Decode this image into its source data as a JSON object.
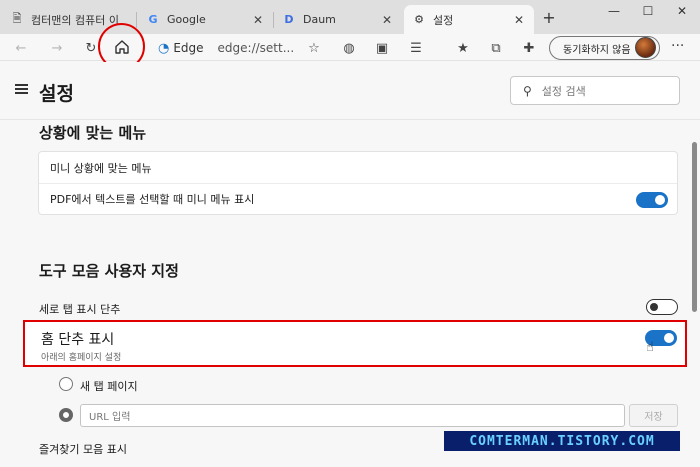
{
  "tabs": [
    {
      "title": "컴터맨의 컴퓨터 이",
      "favicon": "page-icon"
    },
    {
      "title": "Google",
      "favicon": "google-icon"
    },
    {
      "title": "Daum",
      "favicon": "daum-icon"
    },
    {
      "title": "설정",
      "favicon": "gear-icon",
      "active": true
    }
  ],
  "window_controls": {
    "minimize": "—",
    "maximize": "☐",
    "close": "✕"
  },
  "address_bar": {
    "edge_label": "Edge",
    "url": "edge://sett..."
  },
  "profile": {
    "sync_label": "동기화하지 않음"
  },
  "settings": {
    "title": "설정",
    "search_placeholder": "설정 검색"
  },
  "context_menu_section": {
    "title": "상황에 맞는 메뉴",
    "items": [
      {
        "label": "미니 상황에 맞는 메뉴"
      },
      {
        "label": "PDF에서 텍스트를 선택할 때 미니 메뉴 표시",
        "toggle": true
      }
    ]
  },
  "toolbar_section": {
    "title": "도구 모음 사용자 지정",
    "vertical_tabs_label": "세로 탭 표시 단추",
    "vertical_tabs_on": false,
    "home_label": "홈 단추 표시",
    "home_sublabel": "아래의 홈페이지 설정",
    "home_on": true,
    "new_tab_label": "새 탭 페이지",
    "url_placeholder": "URL 입력",
    "save_label": "저장",
    "favorites_bar_label": "즐겨찾기 모음 표시"
  },
  "watermark": "COMTERMAN.TISTORY.COM",
  "colors": {
    "accent": "#1a73c7",
    "highlight": "#e00000"
  }
}
